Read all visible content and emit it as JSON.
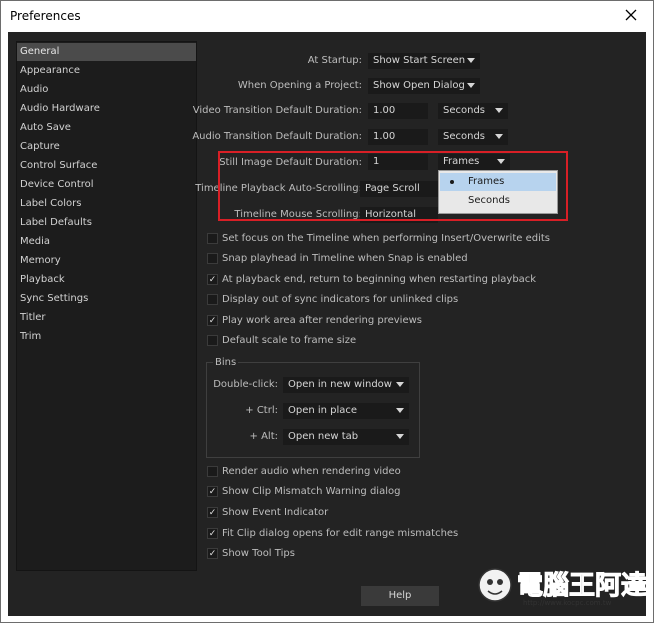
{
  "window": {
    "title": "Preferences"
  },
  "sidebar": {
    "items": [
      {
        "label": "General",
        "selected": true
      },
      {
        "label": "Appearance"
      },
      {
        "label": "Audio"
      },
      {
        "label": "Audio Hardware"
      },
      {
        "label": "Auto Save"
      },
      {
        "label": "Capture"
      },
      {
        "label": "Control Surface"
      },
      {
        "label": "Device Control"
      },
      {
        "label": "Label Colors"
      },
      {
        "label": "Label Defaults"
      },
      {
        "label": "Media"
      },
      {
        "label": "Memory"
      },
      {
        "label": "Playback"
      },
      {
        "label": "Sync Settings"
      },
      {
        "label": "Titler"
      },
      {
        "label": "Trim"
      }
    ]
  },
  "general": {
    "at_startup": {
      "label": "At Startup:",
      "value": "Show Start Screen"
    },
    "opening_project": {
      "label": "When Opening a Project:",
      "value": "Show Open Dialog"
    },
    "video_transition": {
      "label": "Video Transition Default Duration:",
      "value": "1.00",
      "unit": "Seconds"
    },
    "audio_transition": {
      "label": "Audio Transition Default Duration:",
      "value": "1.00",
      "unit": "Seconds"
    },
    "still_image": {
      "label": "Still Image Default Duration:",
      "value": "1",
      "unit": "Frames"
    },
    "playback_scrolling": {
      "label": "Timeline Playback Auto-Scrolling:",
      "value": "Page Scroll"
    },
    "mouse_scrolling": {
      "label": "Timeline Mouse Scrolling:",
      "value": "Horizontal"
    },
    "unit_popup": {
      "options": [
        "Frames",
        "Seconds"
      ],
      "selected": "Frames"
    },
    "checkboxes": [
      {
        "label": "Set focus on the Timeline when performing Insert/Overwrite edits",
        "checked": false
      },
      {
        "label": "Snap playhead in Timeline when Snap is enabled",
        "checked": false
      },
      {
        "label": "At playback end, return to beginning when restarting playback",
        "checked": true
      },
      {
        "label": "Display out of sync indicators for unlinked clips",
        "checked": false
      },
      {
        "label": "Play work area after rendering previews",
        "checked": true
      },
      {
        "label": "Default scale to frame size",
        "checked": false
      }
    ],
    "bins": {
      "title": "Bins",
      "double_click": {
        "label": "Double-click:",
        "value": "Open in new window"
      },
      "ctrl": {
        "label": "+ Ctrl:",
        "value": "Open in place"
      },
      "alt": {
        "label": "+ Alt:",
        "value": "Open new tab"
      }
    },
    "checkboxes2": [
      {
        "label": "Render audio when rendering video",
        "checked": false
      },
      {
        "label": "Show Clip Mismatch Warning dialog",
        "checked": true
      },
      {
        "label": "Show Event Indicator",
        "checked": true
      },
      {
        "label": "Fit Clip dialog opens for edit range mismatches",
        "checked": true
      },
      {
        "label": "Show Tool Tips",
        "checked": true
      }
    ],
    "help_label": "Help"
  },
  "icons": {
    "close": "close-icon",
    "check": "checkmark-icon",
    "caret": "chevron-down-icon"
  },
  "colors": {
    "highlight": "#d81f26",
    "selection": "#b7d3ee",
    "panel": "#232323"
  },
  "watermark": {
    "text": "電腦王阿達",
    "url": "http://www.kocpc.com.tw"
  }
}
